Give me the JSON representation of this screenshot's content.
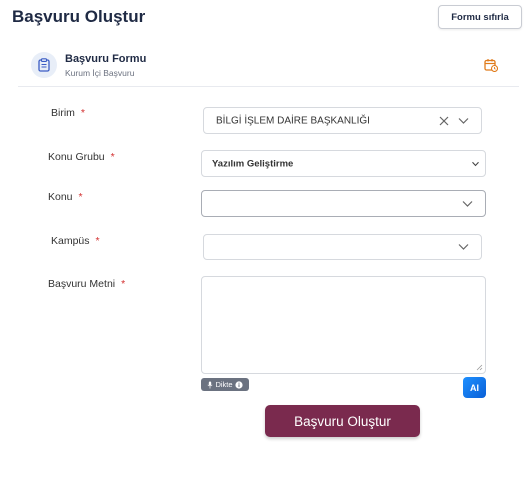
{
  "page": {
    "title": "Başvuru Oluştur",
    "reset_label": "Formu sıfırla"
  },
  "form_header": {
    "title": "Başvuru Formu",
    "subtitle": "Kurum İçi Başvuru",
    "icon": "clipboard-icon",
    "action_icon": "calendar-icon"
  },
  "fields": {
    "birim": {
      "label": "Birim",
      "required": "*",
      "value": "BİLGİ İŞLEM DAİRE BAŞKANLIĞI"
    },
    "konu_grubu": {
      "label": "Konu Grubu",
      "required": "*",
      "value": "Yazılım Geliştirme"
    },
    "konu": {
      "label": "Konu",
      "required": "*",
      "value": ""
    },
    "kampus": {
      "label": "Kampüs",
      "required": "*",
      "value": ""
    },
    "basvuru_metni": {
      "label": "Başvuru Metni",
      "required": "*",
      "value": ""
    }
  },
  "tools": {
    "dikte_label": "Dikte",
    "ai_label": "AI"
  },
  "submit_label": "Başvuru Oluştur",
  "colors": {
    "primary": "#7a2a4e",
    "required": "#d32f2f",
    "accent_icon": "#e07b1a",
    "ai_button": "#1e90ff"
  }
}
